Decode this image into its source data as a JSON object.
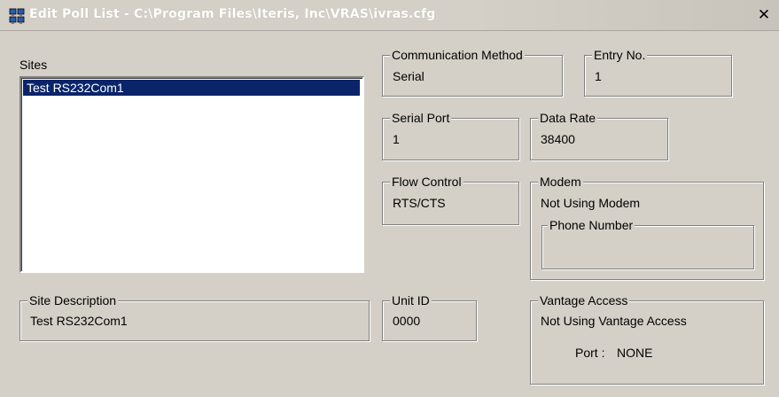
{
  "window": {
    "title": "Edit Poll List - C:\\Program Files\\Iteris, Inc\\VRAS\\ivras.cfg",
    "close_symbol": "✕",
    "icon": "network-computers-icon"
  },
  "sites": {
    "label": "Sites",
    "items": [
      "Test RS232Com1"
    ]
  },
  "communication_method": {
    "label": "Communication Method",
    "value": "Serial"
  },
  "entry_no": {
    "label": "Entry No.",
    "value": "1"
  },
  "serial_port": {
    "label": "Serial Port",
    "value": "1"
  },
  "data_rate": {
    "label": "Data Rate",
    "value": "38400"
  },
  "flow_control": {
    "label": "Flow Control",
    "value": "RTS/CTS"
  },
  "modem": {
    "label": "Modem",
    "value": "Not Using Modem",
    "phone_number": {
      "label": "Phone Number",
      "value": ""
    }
  },
  "site_description": {
    "label": "Site Description",
    "value": "Test RS232Com1"
  },
  "unit_id": {
    "label": "Unit ID",
    "value": "0000"
  },
  "vantage_access": {
    "label": "Vantage Access",
    "value": "Not Using Vantage Access",
    "port_label": "Port :",
    "port_value": "NONE"
  },
  "colors": {
    "face": "#d4d0c8",
    "selection": "#0a246a",
    "shadow": "#808080"
  }
}
